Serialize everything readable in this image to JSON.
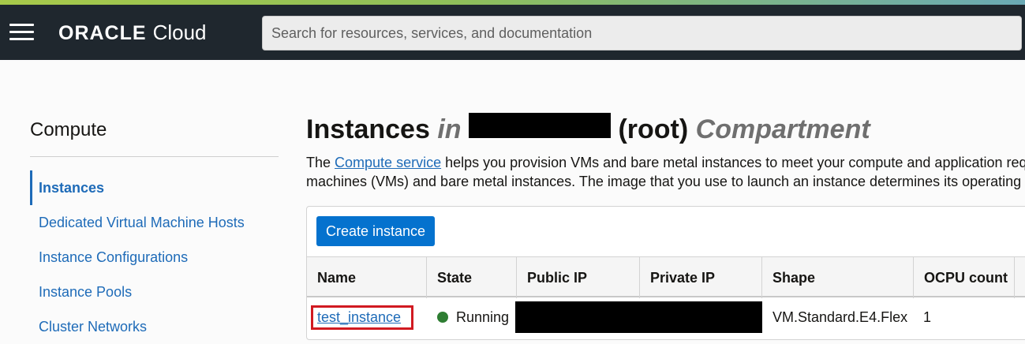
{
  "header": {
    "brand_oracle": "ORACLE",
    "brand_cloud": "Cloud",
    "search_placeholder": "Search for resources, services, and documentation"
  },
  "sidebar": {
    "title": "Compute",
    "items": [
      {
        "label": "Instances",
        "active": true
      },
      {
        "label": "Dedicated Virtual Machine Hosts",
        "active": false
      },
      {
        "label": "Instance Configurations",
        "active": false
      },
      {
        "label": "Instance Pools",
        "active": false
      },
      {
        "label": "Cluster Networks",
        "active": false
      }
    ]
  },
  "main": {
    "title_prefix": "Instances",
    "title_in": "in",
    "title_root": "(root)",
    "title_compartment": "Compartment",
    "desc_lead": "The ",
    "desc_link": "Compute service",
    "desc_line1_rest": " helps you provision VMs and bare metal instances to meet your compute and application requirements. Navigate to a",
    "desc_line2": "machines (VMs) and bare metal instances. The image that you use to launch an instance determines its operating system and other",
    "create_button": "Create instance"
  },
  "table": {
    "columns": [
      "Name",
      "State",
      "Public IP",
      "Private IP",
      "Shape",
      "OCPU count"
    ],
    "rows": [
      {
        "name": "test_instance",
        "state": "Running",
        "shape": "VM.Standard.E4.Flex",
        "ocpu": "1"
      }
    ]
  },
  "colors": {
    "topbar": "#1f272e",
    "link": "#1e6bb8",
    "primary_button": "#0572ce",
    "running": "#2e7d32",
    "highlight_box": "#d11a21"
  }
}
